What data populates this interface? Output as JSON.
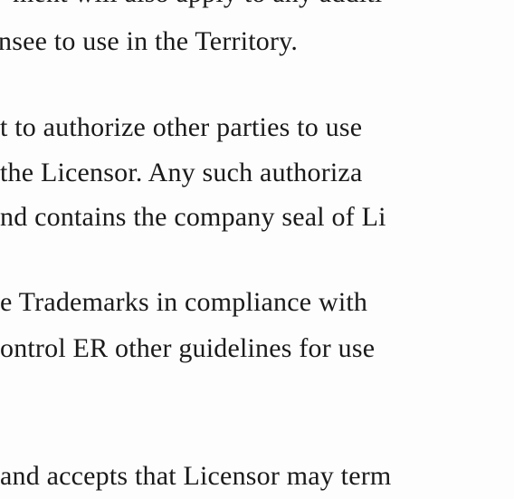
{
  "document": {
    "lines": [
      "ment will also apply to any additi",
      "nsee to use in the Territory.",
      "t to authorize other parties to use",
      "the Licensor.  Any such authoriza",
      "nd contains the company seal of Li",
      "e Trademarks in compliance with",
      "ontrol ER other guidelines for use",
      "and accepts that Licensor may term",
      "                                    "
    ]
  }
}
